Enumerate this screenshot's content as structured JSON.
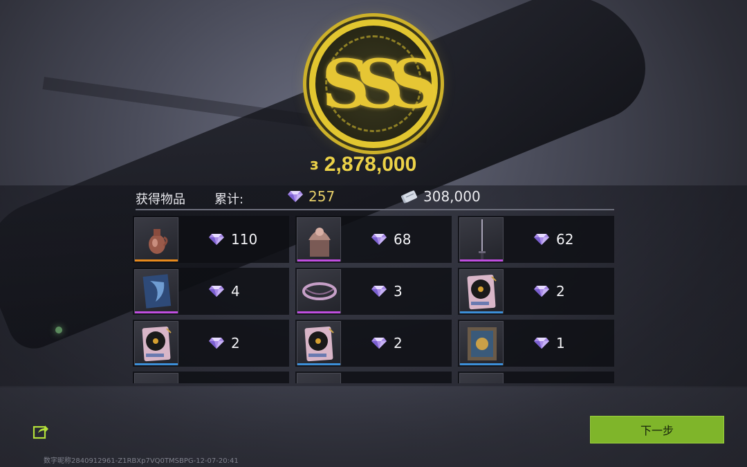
{
  "reward": {
    "currency_icon": "ss-coin-icon",
    "total": "2,878,000",
    "prefix_glyph": "з"
  },
  "header": {
    "obtained_label": "获得物品",
    "cumulative_label": "累计:",
    "gem_total": "257",
    "cash_total": "308,000"
  },
  "items": [
    {
      "icon": "vase-icon",
      "rarity": "orange",
      "gems": "110"
    },
    {
      "icon": "carved-seal-icon",
      "rarity": "purple",
      "gems": "68"
    },
    {
      "icon": "sword-icon",
      "rarity": "purple",
      "gems": "62"
    },
    {
      "icon": "map-tablet-icon",
      "rarity": "purple",
      "gems": "4"
    },
    {
      "icon": "bracelet-icon",
      "rarity": "purple",
      "gems": "3"
    },
    {
      "icon": "vinyl-record-icon",
      "rarity": "blue",
      "gems": "2"
    },
    {
      "icon": "vinyl-record-icon",
      "rarity": "blue",
      "gems": "2"
    },
    {
      "icon": "vinyl-record-icon",
      "rarity": "blue",
      "gems": "2"
    },
    {
      "icon": "framed-painting-icon",
      "rarity": "blue",
      "gems": "1"
    }
  ],
  "buttons": {
    "next_label": "下一步"
  },
  "watermark": "数字昵称2840912961-Z1RBXp7VQ0TMSBPG-12-07-20:41",
  "colors": {
    "accent_green": "#7fb52a",
    "gold": "#e2c630",
    "gem_count": "#e8d06a"
  }
}
